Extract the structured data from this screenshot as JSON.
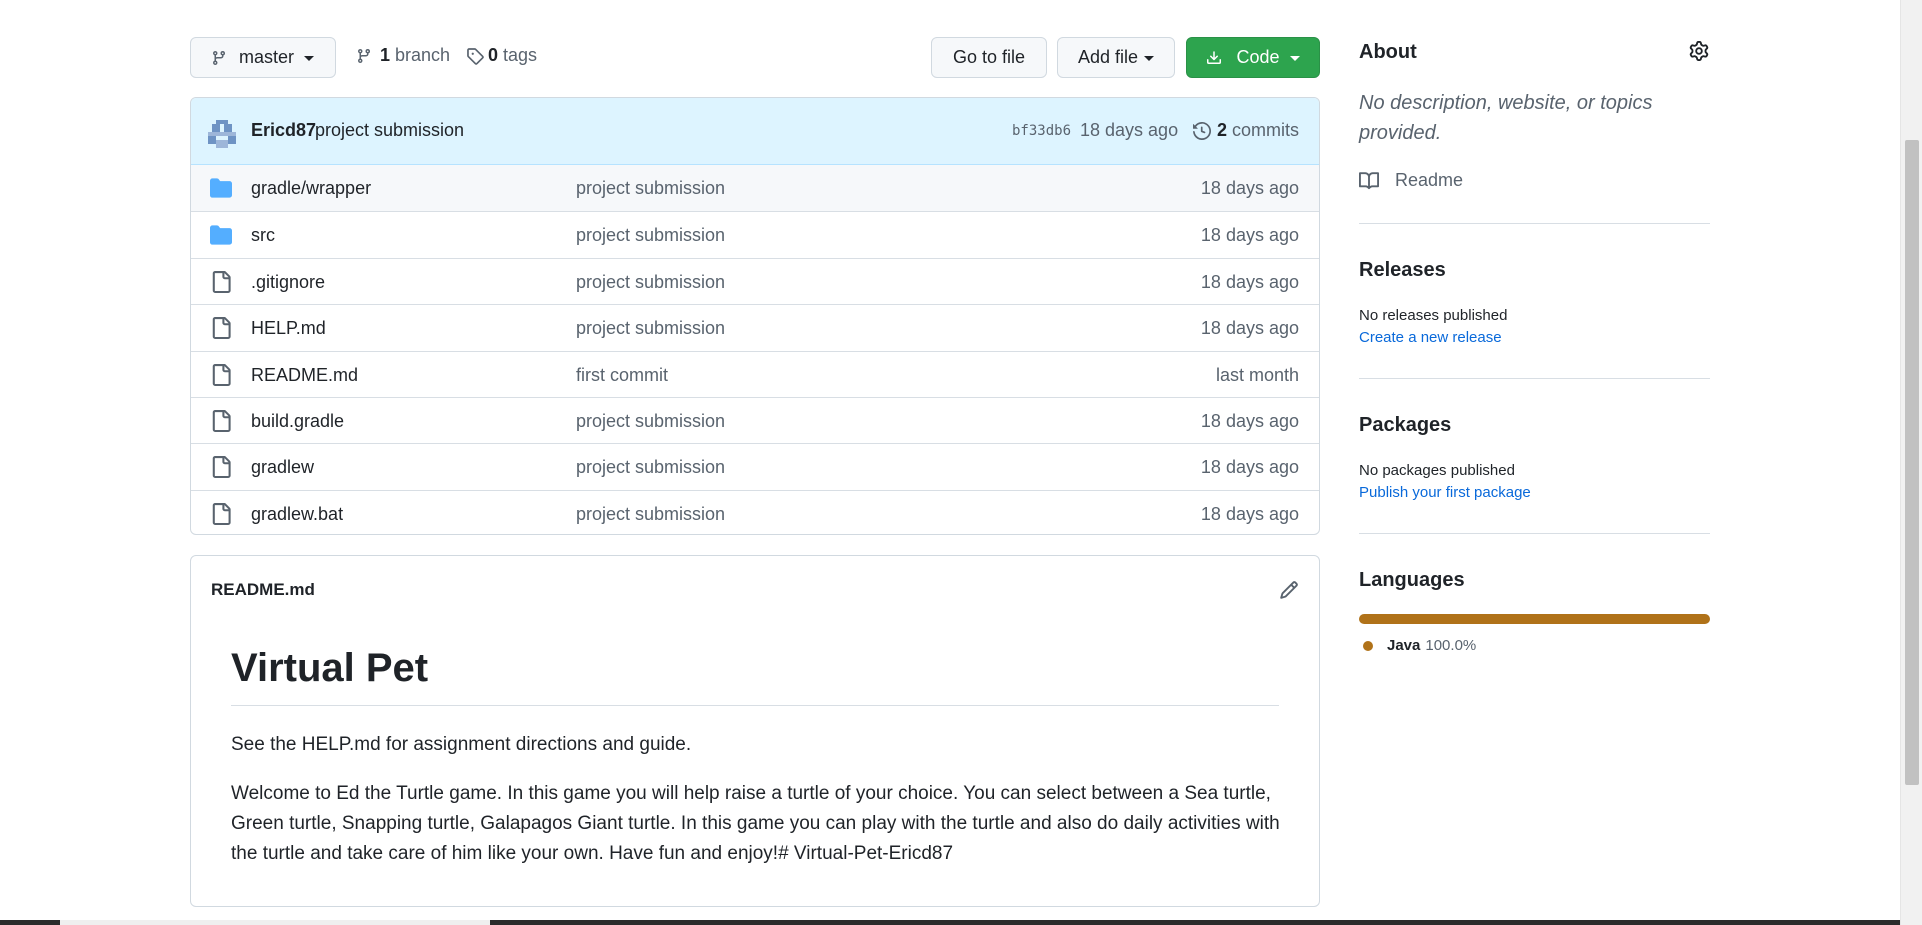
{
  "toolbar": {
    "branch": "master",
    "branch_count": "1",
    "branch_label": "branch",
    "tag_count": "0",
    "tag_label": "tags",
    "goto_file": "Go to file",
    "add_file": "Add file",
    "code": "Code"
  },
  "latest_commit": {
    "author": "Ericd87",
    "message": "project submission",
    "sha": "bf33db6",
    "when": "18 days ago",
    "commit_count": "2",
    "commit_label": "commits"
  },
  "files": [
    {
      "name": "gradle/wrapper",
      "type": "folder",
      "message": "project submission",
      "age": "18 days ago"
    },
    {
      "name": "src",
      "type": "folder",
      "message": "project submission",
      "age": "18 days ago"
    },
    {
      "name": ".gitignore",
      "type": "file",
      "message": "project submission",
      "age": "18 days ago"
    },
    {
      "name": "HELP.md",
      "type": "file",
      "message": "project submission",
      "age": "18 days ago"
    },
    {
      "name": "README.md",
      "type": "file",
      "message": "first commit",
      "age": "last month"
    },
    {
      "name": "build.gradle",
      "type": "file",
      "message": "project submission",
      "age": "18 days ago"
    },
    {
      "name": "gradlew",
      "type": "file",
      "message": "project submission",
      "age": "18 days ago"
    },
    {
      "name": "gradlew.bat",
      "type": "file",
      "message": "project submission",
      "age": "18 days ago"
    }
  ],
  "readme": {
    "filename": "README.md",
    "heading": "Virtual Pet",
    "paragraph1": "See the HELP.md for assignment directions and guide.",
    "paragraph2": "Welcome to Ed the Turtle game. In this game you will help raise a turtle of your choice. You can select between a Sea turtle, Green turtle, Snapping turtle, Galapagos Giant turtle. In this game you can play with the turtle and also do daily activities with the turtle and take care of him like your own. Have fun and enjoy!# Virtual-Pet-Ericd87"
  },
  "sidebar": {
    "about_title": "About",
    "about_desc": "No description, website, or topics provided.",
    "readme_link": "Readme",
    "releases_title": "Releases",
    "releases_none": "No releases published",
    "releases_link": "Create a new release",
    "packages_title": "Packages",
    "packages_none": "No packages published",
    "packages_link": "Publish your first package",
    "languages_title": "Languages",
    "languages": [
      {
        "name": "Java",
        "percent": "100.0%",
        "color": "#b07219"
      }
    ]
  },
  "colors": {
    "primary_button": "#2da44e",
    "link": "#0969da",
    "folder": "#54aeff"
  }
}
